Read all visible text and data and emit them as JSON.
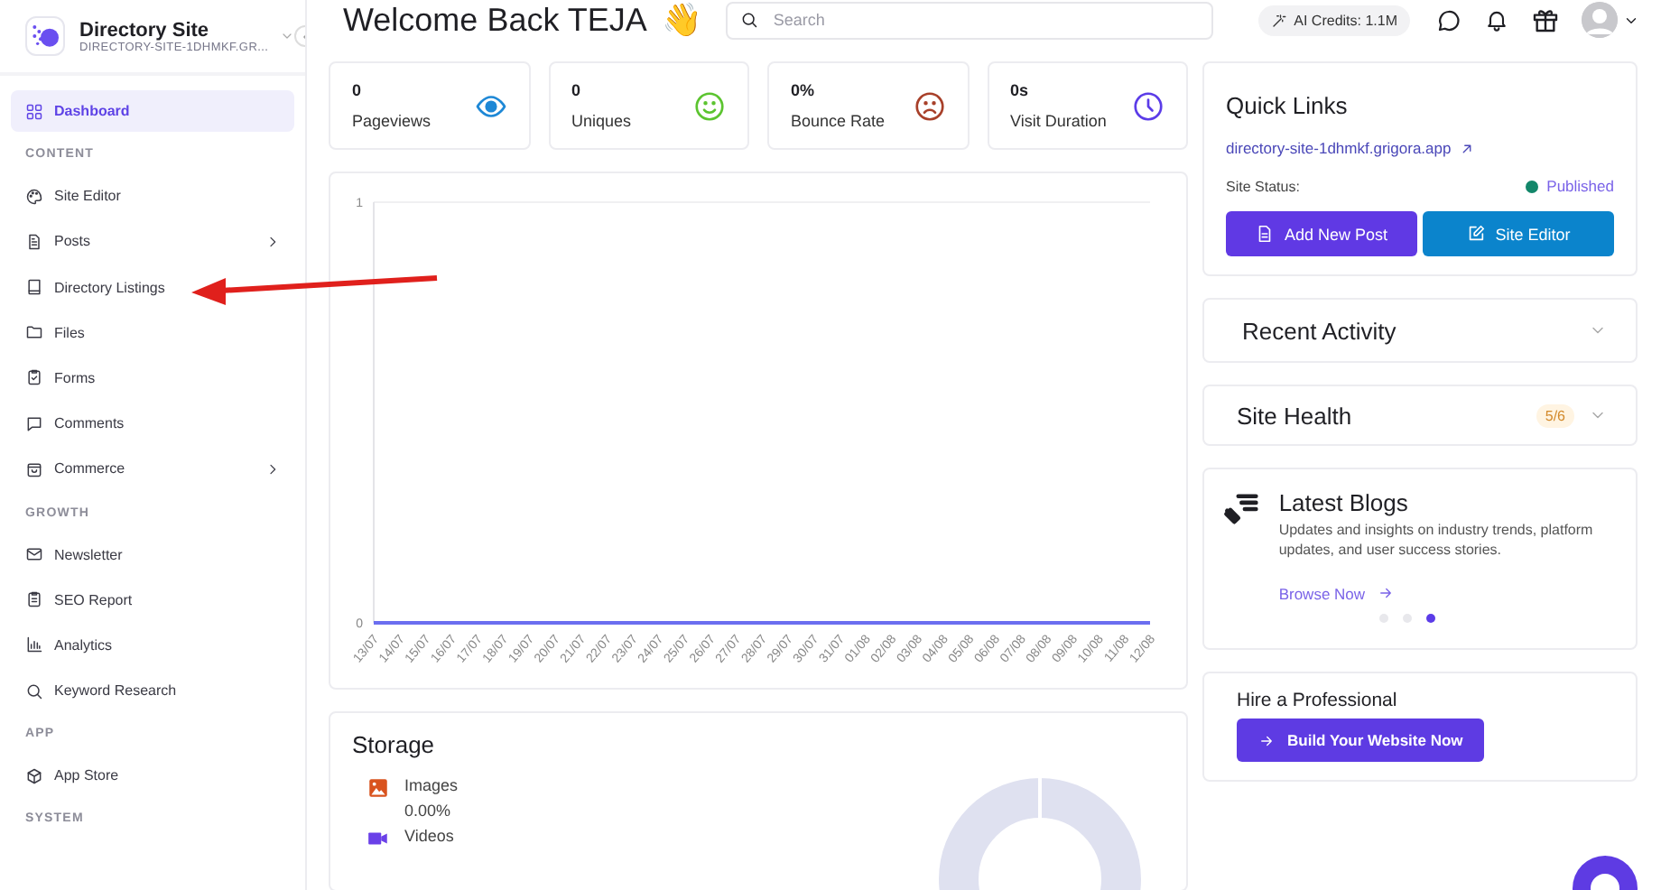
{
  "sidebar": {
    "site_name": "Directory Site",
    "site_url": "DIRECTORY-SITE-1DHMKF.GR...",
    "nav": [
      {
        "kind": "item",
        "label": "Dashboard",
        "selected": true,
        "submenu": false
      },
      {
        "kind": "section",
        "label": "CONTENT"
      },
      {
        "kind": "item",
        "label": "Site Editor",
        "selected": false,
        "submenu": false
      },
      {
        "kind": "item",
        "label": "Posts",
        "selected": false,
        "submenu": true
      },
      {
        "kind": "item",
        "label": "Directory Listings",
        "selected": false,
        "submenu": false
      },
      {
        "kind": "item",
        "label": "Files",
        "selected": false,
        "submenu": false
      },
      {
        "kind": "item",
        "label": "Forms",
        "selected": false,
        "submenu": false
      },
      {
        "kind": "item",
        "label": "Comments",
        "selected": false,
        "submenu": false
      },
      {
        "kind": "item",
        "label": "Commerce",
        "selected": false,
        "submenu": true
      },
      {
        "kind": "section",
        "label": "GROWTH"
      },
      {
        "kind": "item",
        "label": "Newsletter",
        "selected": false,
        "submenu": false
      },
      {
        "kind": "item",
        "label": "SEO Report",
        "selected": false,
        "submenu": false
      },
      {
        "kind": "item",
        "label": "Analytics",
        "selected": false,
        "submenu": false
      },
      {
        "kind": "item",
        "label": "Keyword Research",
        "selected": false,
        "submenu": false
      },
      {
        "kind": "section",
        "label": "APP"
      },
      {
        "kind": "item",
        "label": "App Store",
        "selected": false,
        "submenu": false
      },
      {
        "kind": "section",
        "label": "SYSTEM"
      }
    ]
  },
  "header": {
    "title": "Welcome Back TEJA",
    "emoji": "👋",
    "search": {
      "placeholder": "Search"
    },
    "ai_credits": "AI Credits: 1.1M"
  },
  "stats": [
    {
      "kind": "eye",
      "value": "0",
      "label": "Pageviews"
    },
    {
      "kind": "smile",
      "value": "0",
      "label": "Uniques"
    },
    {
      "kind": "frown",
      "value": "0%",
      "label": "Bounce Rate"
    },
    {
      "kind": "clock",
      "value": "0s",
      "label": "Visit Duration"
    }
  ],
  "traffic": {
    "chart_data": {
      "type": "line",
      "categories": [
        "13/07",
        "14/07",
        "15/07",
        "16/07",
        "17/07",
        "18/07",
        "19/07",
        "20/07",
        "21/07",
        "22/07",
        "23/07",
        "24/07",
        "25/07",
        "26/07",
        "27/07",
        "28/07",
        "29/07",
        "30/07",
        "31/07",
        "01/08",
        "02/08",
        "03/08",
        "04/08",
        "05/08",
        "06/08",
        "07/08",
        "08/08",
        "09/08",
        "10/08",
        "11/08",
        "12/08"
      ],
      "series": [
        {
          "color": "#6b6ef0",
          "values": [
            0,
            0,
            0,
            0,
            0,
            0,
            0,
            0,
            0,
            0,
            0,
            0,
            0,
            0,
            0,
            0,
            0,
            0,
            0,
            0,
            0,
            0,
            0,
            0,
            0,
            0,
            0,
            0,
            0,
            0,
            0
          ]
        }
      ],
      "ylim": [
        0,
        1
      ],
      "yticks": [
        0,
        1
      ]
    }
  },
  "storage": {
    "title": "Storage",
    "items": [
      {
        "kind": "images",
        "label": "Images",
        "value": "0.00%"
      },
      {
        "kind": "videos",
        "label": "Videos"
      }
    ]
  },
  "quick_links": {
    "title": "Quick Links",
    "url": "directory-site-1dhmkf.grigora.app",
    "status_label": "Site Status:",
    "status": "Published",
    "buttons": [
      {
        "kind": "post",
        "label": "Add New Post"
      },
      {
        "kind": "editor",
        "label": "Site Editor"
      }
    ]
  },
  "recent_activity": {
    "title": "Recent Activity"
  },
  "site_health": {
    "title": "Site Health",
    "score": "5/6"
  },
  "latest_blogs": {
    "title": "Latest Blogs",
    "text": "Updates and insights on industry trends, platform updates, and user success stories.",
    "link": "Browse Now",
    "slides": [
      {
        "selected": false
      },
      {
        "selected": false
      },
      {
        "selected": true
      }
    ]
  },
  "hire": {
    "title": "Hire a Professional",
    "button": "Build Your Website Now"
  }
}
